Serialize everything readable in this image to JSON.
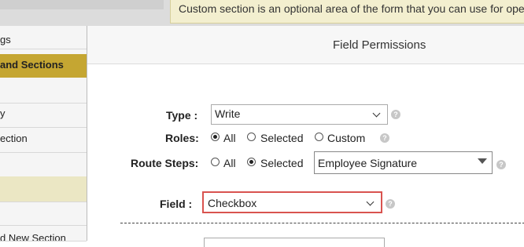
{
  "notice": {
    "text": "Custom section is an optional area of the form that you can use for open and"
  },
  "sidebar": {
    "items": [
      {
        "label": "gs"
      },
      {
        "label": "and Sections"
      },
      {
        "label": ""
      },
      {
        "label": "y"
      },
      {
        "label": "ection"
      },
      {
        "label": ""
      },
      {
        "label": ""
      },
      {
        "label": "d New Section"
      }
    ]
  },
  "modal": {
    "title": "Field Permissions",
    "type": {
      "label": "Type :",
      "value": "Write"
    },
    "roles": {
      "label": "Roles:",
      "options": [
        "All",
        "Selected",
        "Custom"
      ],
      "selected": "All"
    },
    "route_steps": {
      "label": "Route Steps:",
      "options": [
        "All",
        "Selected"
      ],
      "selected": "Selected",
      "dropdown_value": "Employee Signature"
    },
    "field": {
      "label": "Field :",
      "value": "Checkbox",
      "highlight_color": "#d9534f"
    },
    "help_icon": "question-icon"
  },
  "colors": {
    "active_sidebar": "#c5a632",
    "notice_bg": "#f3efcf",
    "highlight": "#d9534f"
  }
}
